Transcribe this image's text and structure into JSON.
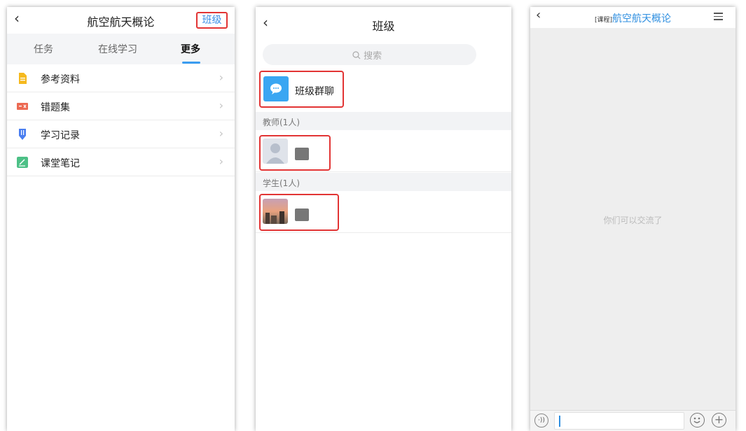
{
  "course_page": {
    "title": "航空航天概论",
    "class_button": "班级",
    "tabs": [
      {
        "label": "任务"
      },
      {
        "label": "在线学习"
      },
      {
        "label": "更多"
      }
    ],
    "items": [
      {
        "label": "参考资料",
        "icon": "document-icon",
        "color": "#f5b91e"
      },
      {
        "label": "错题集",
        "icon": "error-book-icon",
        "color": "#ec6a53"
      },
      {
        "label": "学习记录",
        "icon": "record-icon",
        "color": "#4a7ef0"
      },
      {
        "label": "课堂笔记",
        "icon": "note-icon",
        "color": "#4cc086"
      }
    ]
  },
  "class_page": {
    "title": "班级",
    "search_placeholder": "搜索",
    "group_chat": "班级群聊",
    "teacher_section": "教师(1人)",
    "student_section": "学生(1人)"
  },
  "chat_page": {
    "tag": "[课程]",
    "course_name": "航空航天概论",
    "empty_message": "你们可以交流了"
  },
  "colors": {
    "accent_blue": "#3a8ee6",
    "highlight_red": "#e23434"
  }
}
